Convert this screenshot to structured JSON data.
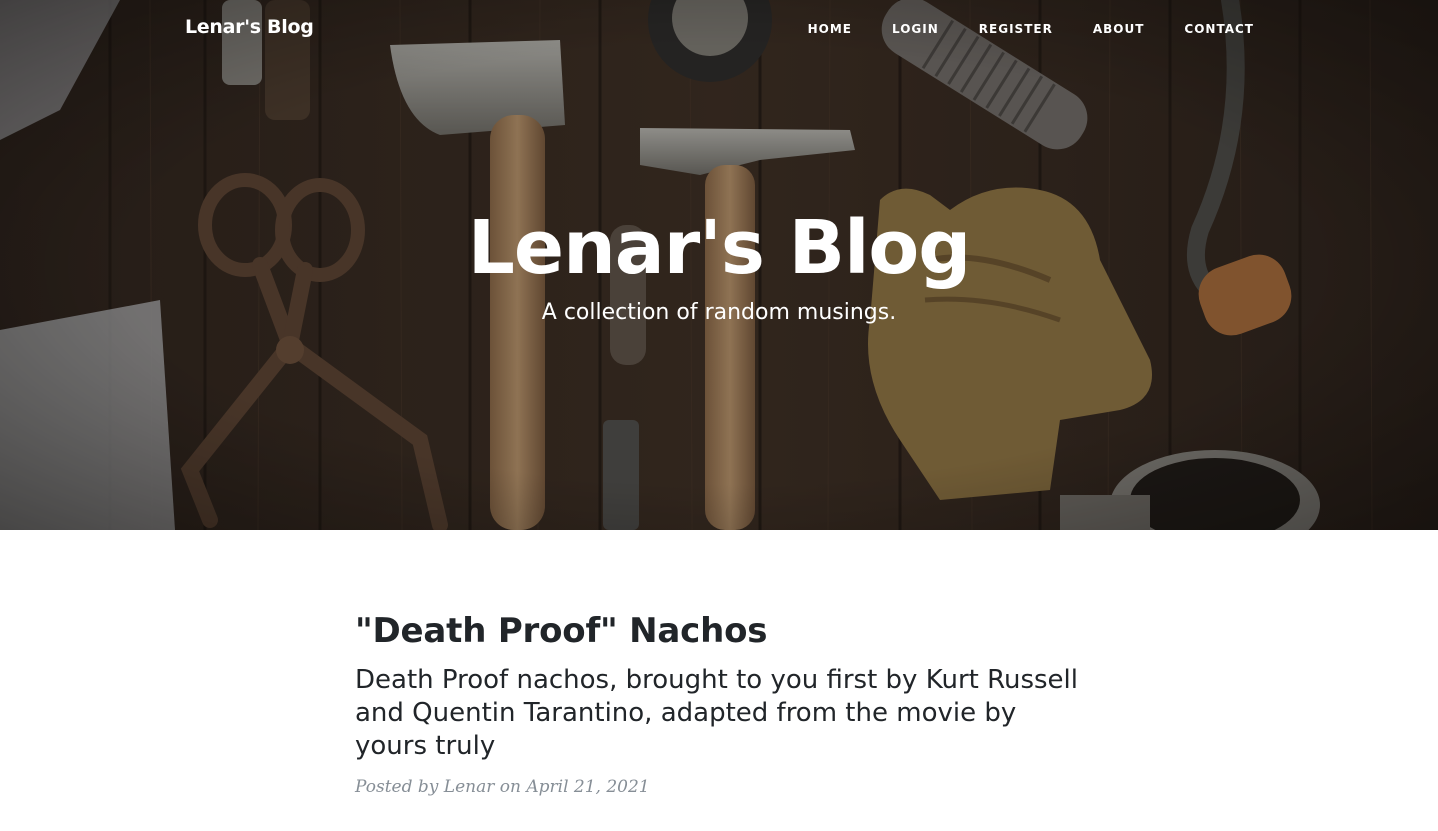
{
  "navbar": {
    "brand": "Lenar's Blog",
    "links": [
      {
        "label": "HOME"
      },
      {
        "label": "LOGIN"
      },
      {
        "label": "REGISTER"
      },
      {
        "label": "ABOUT"
      },
      {
        "label": "CONTACT"
      }
    ]
  },
  "header": {
    "title": "Lenar's Blog",
    "subtitle": "A collection of random musings.",
    "background_icon": "tools-on-wood-photo"
  },
  "posts": [
    {
      "title": "\"Death Proof\" Nachos",
      "subtitle": "Death Proof nachos, brought to you first by Kurt Russell and Quentin Tarantino, adapted from the movie by yours truly",
      "meta_prefix": "Posted by",
      "author": "Lenar",
      "meta_on": "on",
      "date": "April 21, 2021"
    }
  ],
  "colors": {
    "text_dark": "#212529",
    "meta_gray": "#868e96",
    "hero_wood": "#3a2c22"
  }
}
